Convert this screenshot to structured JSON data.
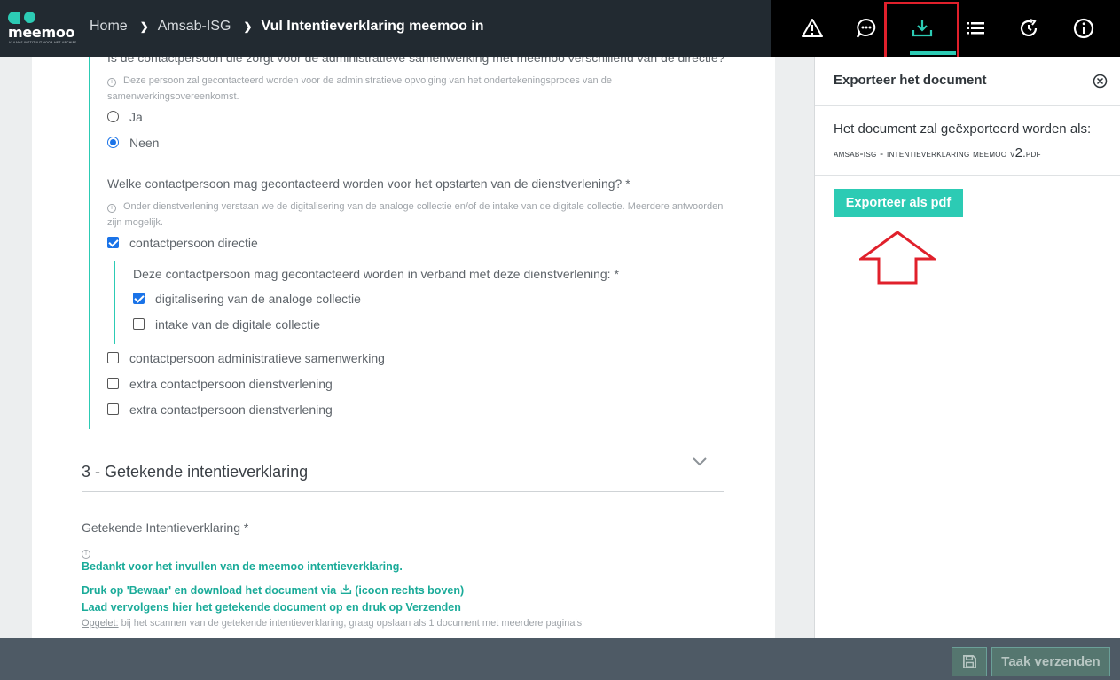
{
  "app": {
    "logo_word": "meemoo",
    "logo_tagline": "VLAAMS INSTITUUT VOOR HET ARCHIEF"
  },
  "breadcrumb": {
    "home": "Home",
    "org": "Amsab-ISG",
    "current": "Vul Intentieverklaring meemoo in"
  },
  "toolbar": {
    "icons": [
      "warning-icon",
      "comment-icon",
      "download-icon",
      "list-icon",
      "history-icon",
      "info-icon"
    ],
    "active": "download-icon",
    "accent_color": "#2ccbb4",
    "highlight_color": "#e0202b"
  },
  "form": {
    "q1_text": "Is de contactpersoon die zorgt voor de administratieve samenwerking met meemoo verschillend van de directie?",
    "q1_hint": "Deze persoon zal gecontacteerd worden voor de administratieve opvolging van het ondertekeningsproces van de samenwerkingsovereenkomst.",
    "q1_options": [
      {
        "label": "Ja",
        "selected": false
      },
      {
        "label": "Neen",
        "selected": true
      }
    ],
    "q2_text": "Welke contactpersoon mag gecontacteerd worden voor het opstarten van de dienstverlening? *",
    "q2_hint": "Onder dienstverlening verstaan we de digitalisering van de analoge collectie en/of de intake van de digitale collectie. Meerdere antwoorden zijn mogelijk.",
    "q2_options": [
      {
        "label": "contactpersoon directie",
        "checked": true
      },
      {
        "label": "contactpersoon administratieve samenwerking",
        "checked": false
      },
      {
        "label": "extra contactpersoon dienstverlening",
        "checked": false
      },
      {
        "label": "extra contactpersoon dienstverlening",
        "checked": false
      }
    ],
    "sub_question": "Deze contactpersoon mag gecontacteerd worden in verband met deze dienstverlening: *",
    "sub_options": [
      {
        "label": "digitalisering van de analoge collectie",
        "checked": true
      },
      {
        "label": "intake van de digitale collectie",
        "checked": false
      }
    ],
    "section3_title": "3 - Getekende intentieverklaring",
    "signed_label": "Getekende Intentieverklaring *",
    "thanks_line": "Bedankt voor het invullen van de meemoo intentieverklaring.",
    "instruction_line1_a": "Druk op 'Bewaar' en download het document via",
    "instruction_line1_b": "(icoon rechts boven)",
    "instruction_line2": "Laad vervolgens hier het getekende document op en druk op Verzenden",
    "note_label": "Opgelet:",
    "note_text": " bij het scannen van de getekende intentieverklaring, graag opslaan als 1 document met meerdere pagina's"
  },
  "export_panel": {
    "title": "Exporteer het document",
    "intro": "Het document zal geëxporteerd worden als:",
    "filename_main": "amsab-isg - intentieverklaring meemoo v",
    "filename_version": "2",
    "filename_ext": ".pdf",
    "button_label": "Exporteer als pdf"
  },
  "footer": {
    "send_label": "Taak verzenden"
  }
}
